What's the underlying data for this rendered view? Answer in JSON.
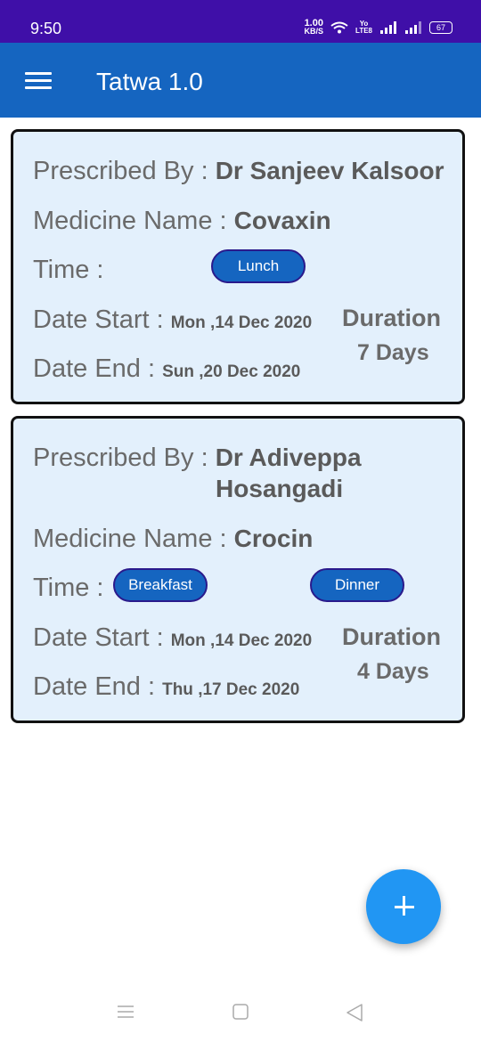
{
  "status_bar": {
    "time": "9:50",
    "net_speed_value": "1.00",
    "net_speed_unit": "KB/S",
    "volte_top": "Yo",
    "volte_bottom": "LTE8",
    "battery": "67"
  },
  "app_bar": {
    "title": "Tatwa 1.0",
    "menu_icon": "hamburger-menu-icon"
  },
  "prescriptions": [
    {
      "prescribed_by_label": "Prescribed By : ",
      "doctor": "Dr Sanjeev Kalsoor",
      "medicine_label": "Medicine Name : ",
      "medicine": "Covaxin",
      "time_label": "Time :",
      "times": [
        "Lunch"
      ],
      "date_start_label": "Date Start : ",
      "date_start": "Mon ,14 Dec 2020",
      "date_end_label": "Date End : ",
      "date_end": "Sun ,20 Dec 2020",
      "duration_label": "Duration",
      "duration": "7 Days"
    },
    {
      "prescribed_by_label": "Prescribed By : ",
      "doctor_line1": "Dr Adiveppa",
      "doctor_line2": "Hosangadi",
      "medicine_label": "Medicine Name : ",
      "medicine": "Crocin",
      "time_label": "Time : ",
      "times": [
        "Breakfast",
        "Dinner"
      ],
      "date_start_label": "Date Start : ",
      "date_start": "Mon ,14 Dec 2020",
      "date_end_label": "Date End : ",
      "date_end": "Thu ,17 Dec 2020",
      "duration_label": "Duration",
      "duration": "4 Days"
    }
  ],
  "fab": {
    "icon": "plus-icon"
  },
  "nav_bar": {
    "icons": [
      "recents-icon",
      "home-icon",
      "back-icon"
    ]
  },
  "colors": {
    "status_bar": "#3f0fa8",
    "app_bar": "#1565c0",
    "card_bg": "#e3f0fc",
    "pill": "#1565c0",
    "fab": "#2196f3"
  }
}
